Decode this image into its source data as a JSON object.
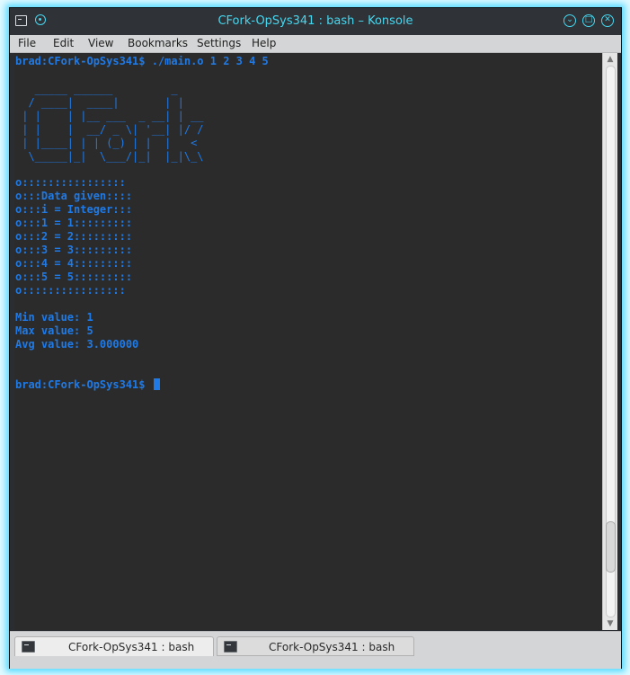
{
  "window": {
    "title": "CFork-OpSys341 : bash – Konsole",
    "buttons": {
      "minimize": "⌄",
      "maximize": "□",
      "close": "✕"
    }
  },
  "menu": {
    "items": [
      "File",
      "Edit",
      "View",
      "Bookmarks",
      "Settings",
      "Help"
    ]
  },
  "terminal": {
    "command_line": "brad:CFork-OpSys341$ ./main.o 1 2 3 4 5",
    "ascii_art": [
      "   _____ ______         _",
      "  / ____|  ____|       | |",
      " | |    | |__ ___  _ __| | __",
      " | |    |  __/ _ \\| '__| |/ /",
      " | |____| | | (_) | |  |   <",
      "  \\_____|_|  \\___/|_|  |_|\\_\\"
    ],
    "data_block": [
      "o::::::::::::::::",
      "o:::Data given::::",
      "o:::i = Integer:::",
      "o:::1 = 1:::::::::",
      "o:::2 = 2:::::::::",
      "o:::3 = 3:::::::::",
      "o:::4 = 4:::::::::",
      "o:::5 = 5:::::::::",
      "o::::::::::::::::"
    ],
    "min_line": "Min value: 1",
    "max_line": "Max value: 5",
    "avg_line": "Avg value: 3.000000",
    "prompt": "brad:CFork-OpSys341$ ",
    "text_color": "#1f7ae6",
    "background_color": "#2b2b2b"
  },
  "scrollbar": {
    "position_fraction": 0.91,
    "visible_fraction": 0.09
  },
  "tabs": [
    {
      "label": "CFork-OpSys341 : bash",
      "active": true
    },
    {
      "label": "CFork-OpSys341 : bash",
      "active": false
    }
  ],
  "icons": {
    "app": "terminal-icon",
    "pin": "pin-icon",
    "tab": "terminal-icon"
  },
  "colors": {
    "title_accent": "#46d7f0",
    "window_glow": "#5fdcff"
  }
}
